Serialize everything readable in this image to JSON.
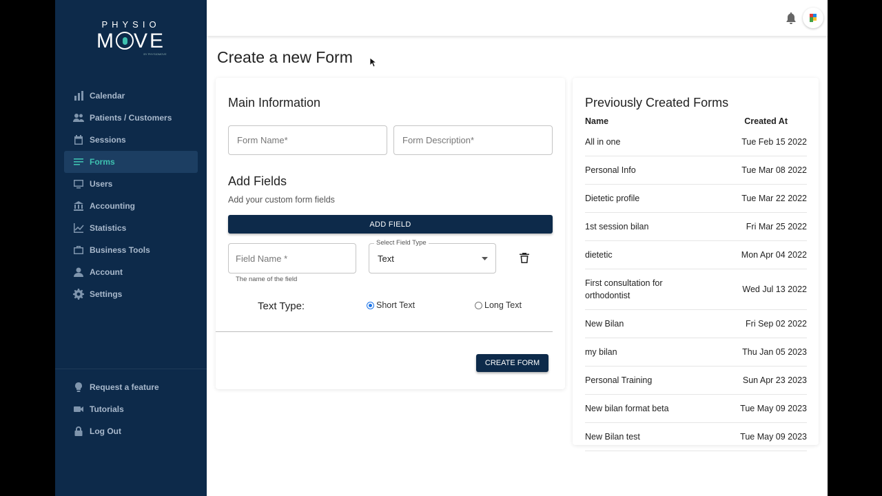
{
  "logo": {
    "top": "PHYSIO",
    "main_before": "M",
    "main_after": "VE",
    "tagline": "BY PHYSIOMOVE"
  },
  "sidebar": {
    "items": [
      {
        "label": "Calendar",
        "icon": "bar-chart-icon"
      },
      {
        "label": "Patients / Customers",
        "icon": "people-icon"
      },
      {
        "label": "Sessions",
        "icon": "calendar-icon"
      },
      {
        "label": "Forms",
        "icon": "list-icon",
        "active": true
      },
      {
        "label": "Users",
        "icon": "monitor-icon"
      },
      {
        "label": "Accounting",
        "icon": "bank-icon"
      },
      {
        "label": "Statistics",
        "icon": "line-chart-icon"
      },
      {
        "label": "Business Tools",
        "icon": "briefcase-icon"
      },
      {
        "label": "Account",
        "icon": "person-icon"
      },
      {
        "label": "Settings",
        "icon": "gear-icon"
      }
    ],
    "bottom_items": [
      {
        "label": "Request a feature",
        "icon": "lightbulb-icon"
      },
      {
        "label": "Tutorials",
        "icon": "video-icon"
      },
      {
        "label": "Log Out",
        "icon": "lock-icon"
      }
    ]
  },
  "page_title": "Create a new Form",
  "form": {
    "main_info_title": "Main Information",
    "form_name_placeholder": "Form Name*",
    "form_description_placeholder": "Form Description*",
    "add_fields_title": "Add Fields",
    "add_fields_subtitle": "Add your custom form fields",
    "add_field_button": "ADD FIELD",
    "field_name_placeholder": "Field Name *",
    "field_name_helper": "The name of the field",
    "select_field_type_label": "Select Field Type",
    "select_field_type_value": "Text",
    "text_type_label": "Text Type:",
    "radio_short": "Short Text",
    "radio_long": "Long Text",
    "selected_text_type": "Short Text",
    "create_button": "CREATE FORM"
  },
  "previous_forms": {
    "title": "Previously Created Forms",
    "col_name": "Name",
    "col_created": "Created At",
    "rows": [
      {
        "name": "All in one",
        "date": "Tue Feb 15 2022"
      },
      {
        "name": "Personal Info",
        "date": "Tue Mar 08 2022"
      },
      {
        "name": "Dietetic profile",
        "date": "Tue Mar 22 2022"
      },
      {
        "name": "1st session bilan",
        "date": "Fri Mar 25 2022"
      },
      {
        "name": "dietetic",
        "date": "Mon Apr 04 2022"
      },
      {
        "name": "First consultation for orthodontist",
        "date": "Wed Jul 13 2022"
      },
      {
        "name": "New Bilan",
        "date": "Fri Sep 02 2022"
      },
      {
        "name": "my bilan",
        "date": "Thu Jan 05 2023"
      },
      {
        "name": "Personal Training",
        "date": "Sun Apr 23 2023"
      },
      {
        "name": "New bilan format beta",
        "date": "Tue May 09 2023"
      },
      {
        "name": "New Bilan test",
        "date": "Tue May 09 2023"
      }
    ]
  },
  "colors": {
    "sidebar_bg": "#0d2a4a",
    "accent": "#3ec1b0",
    "primary_button": "#0d2a4a",
    "radio_selected": "#1a73e8"
  }
}
